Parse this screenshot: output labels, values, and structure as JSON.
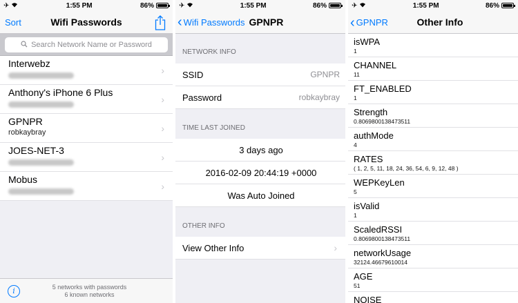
{
  "status": {
    "time": "1:55 PM",
    "battery": "86%",
    "battery_level": 0.86
  },
  "panel1": {
    "nav_left": "Sort",
    "title": "Wifi Passwords",
    "search_placeholder": "Search Network Name or Password",
    "networks": [
      {
        "name": "Interwebz",
        "password": ""
      },
      {
        "name": "Anthony's iPhone 6 Plus",
        "password": ""
      },
      {
        "name": "GPNPR",
        "password": "robkaybray"
      },
      {
        "name": "JOES-NET-3",
        "password": ""
      },
      {
        "name": "Mobus",
        "password": ""
      }
    ],
    "footer_line1": "5 networks with passwords",
    "footer_line2": "6 known networks"
  },
  "panel2": {
    "back_label": "Wifi Passwords",
    "title": "GPNPR",
    "network_info_header": "NETWORK INFO",
    "ssid_label": "SSID",
    "ssid_value": "GPNPR",
    "password_label": "Password",
    "password_value": "robkaybray",
    "time_header": "TIME LAST JOINED",
    "time_ago": "3 days ago",
    "time_stamp": "2016-02-09 20:44:19 +0000",
    "auto_joined": "Was Auto Joined",
    "other_header": "OTHER INFO",
    "view_other": "View Other Info"
  },
  "panel3": {
    "back_label": "GPNPR",
    "title": "Other Info",
    "items": [
      {
        "key": "isWPA",
        "value": "1"
      },
      {
        "key": "CHANNEL",
        "value": "11"
      },
      {
        "key": "FT_ENABLED",
        "value": "1"
      },
      {
        "key": "Strength",
        "value": "0.8069800138473511"
      },
      {
        "key": "authMode",
        "value": "4"
      },
      {
        "key": "RATES",
        "value": "( 1, 2, 5, 11, 18, 24, 36, 54, 6, 9, 12, 48 )"
      },
      {
        "key": "WEPKeyLen",
        "value": "5"
      },
      {
        "key": "isValid",
        "value": "1"
      },
      {
        "key": "ScaledRSSI",
        "value": "0.8069800138473511"
      },
      {
        "key": "networkUsage",
        "value": "32124.46679610014"
      },
      {
        "key": "AGE",
        "value": "51"
      },
      {
        "key": "NOISE",
        "value": ""
      }
    ]
  },
  "colors": {
    "accent": "#007aff",
    "separator": "#c8c7cc",
    "group_bg": "#efeff4"
  },
  "icons": {
    "share": "share-icon",
    "search": "search-icon",
    "info": "info-icon",
    "chevron": "chevron-right-icon",
    "back": "chevron-left-icon",
    "wifi": "wifi-icon",
    "airplane": "airplane-icon"
  }
}
